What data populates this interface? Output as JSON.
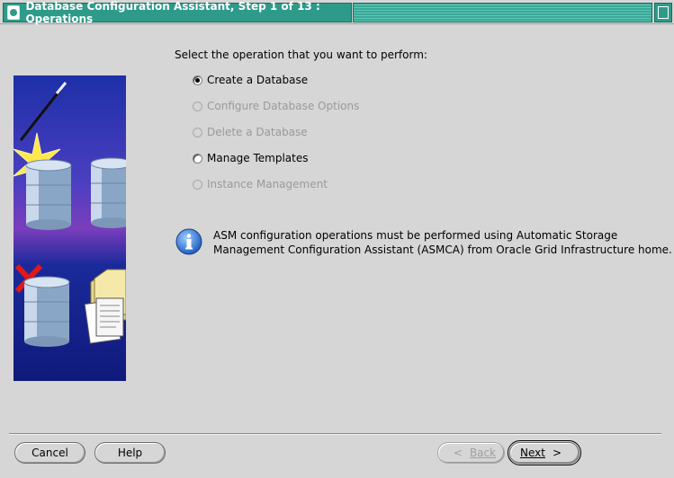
{
  "window": {
    "title": "Database Configuration Assistant, Step 1 of 13 : Operations"
  },
  "main": {
    "prompt": "Select the operation that you want to perform:",
    "options": [
      {
        "label": "Create a Database",
        "selected": true,
        "enabled": true
      },
      {
        "label": "Configure Database Options",
        "selected": false,
        "enabled": false
      },
      {
        "label": "Delete a Database",
        "selected": false,
        "enabled": false
      },
      {
        "label": "Manage Templates",
        "selected": false,
        "enabled": true
      },
      {
        "label": "Instance Management",
        "selected": false,
        "enabled": false
      }
    ],
    "info": {
      "line1": "ASM configuration operations must be performed using Automatic Storage",
      "line2": "Management Configuration Assistant (ASMCA) from Oracle Grid Infrastructure home."
    }
  },
  "buttons": {
    "cancel": "Cancel",
    "help": "Help",
    "back": "Back",
    "next": "Next",
    "back_arrow": "<",
    "next_arrow": ">"
  },
  "colors": {
    "titlebar": "#2e9b8a",
    "background": "#d6d6d6",
    "panel_art": "#1e2fa8"
  }
}
